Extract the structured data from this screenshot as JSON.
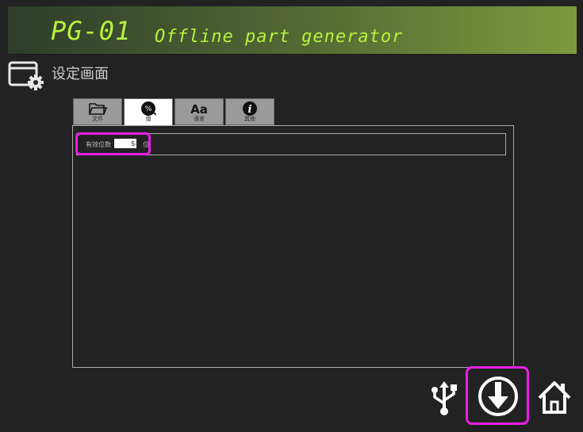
{
  "header": {
    "code": "PG-01",
    "title": "Offline part generator"
  },
  "settings": {
    "icon": "settings-window-icon",
    "title": "设定画面"
  },
  "tabs": [
    {
      "label": "文件",
      "icon": "folder-icon",
      "active": false
    },
    {
      "label": "值",
      "icon": "percent-icon",
      "active": true
    },
    {
      "label": "语言",
      "icon": "font-aa-icon",
      "active": false
    },
    {
      "label": "其他",
      "icon": "info-icon",
      "active": false
    }
  ],
  "field": {
    "label": "有效位数",
    "value": "5",
    "unit": "位"
  },
  "bottom": {
    "usb_icon": "usb-icon",
    "download_icon": "download-circle-icon",
    "home_icon": "home-icon"
  },
  "colors": {
    "accent_text": "#b8f23c",
    "highlight": "#e81ee8",
    "background": "#222222"
  }
}
